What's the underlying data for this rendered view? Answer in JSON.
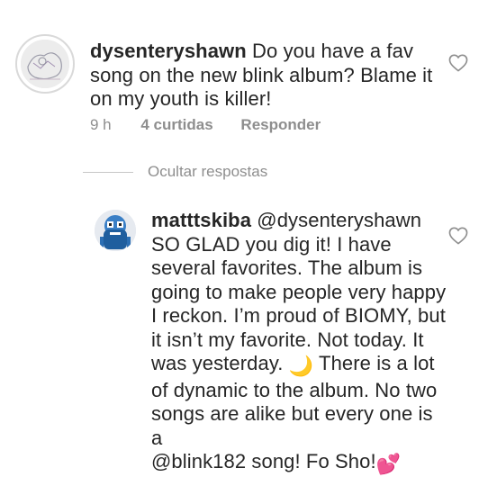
{
  "comments": [
    {
      "username": "dysenteryshawn",
      "text_lines": [
        "Do you have a fav",
        "song on the new blink album? Blame it",
        "on my youth is killer!"
      ],
      "time": "9 h",
      "likes": "4 curtidas",
      "reply": "Responder"
    }
  ],
  "hide_replies": "Ocultar respostas",
  "reply_comment": {
    "username": "matttskiba",
    "mention": "@dysenteryshawn",
    "lines": [
      "SO GLAD you dig it! I have",
      "several favorites. The album is",
      "going to make people very happy",
      "I reckon. I’m proud of BIOMY, but",
      "it isn’t my favorite. Not today. It",
      "was yesterday.",
      "There is a lot",
      "of dynamic to the album. No two",
      "songs are alike but every one is a",
      "@blink182 song! Fo Sho!"
    ],
    "moon_emoji": "🌙",
    "heart_emoji": "💕"
  },
  "icons": {
    "like": "heart-outline-icon"
  },
  "colors": {
    "text": "#262626",
    "meta": "#8e8e8e",
    "divider": "#c7c7c7"
  }
}
